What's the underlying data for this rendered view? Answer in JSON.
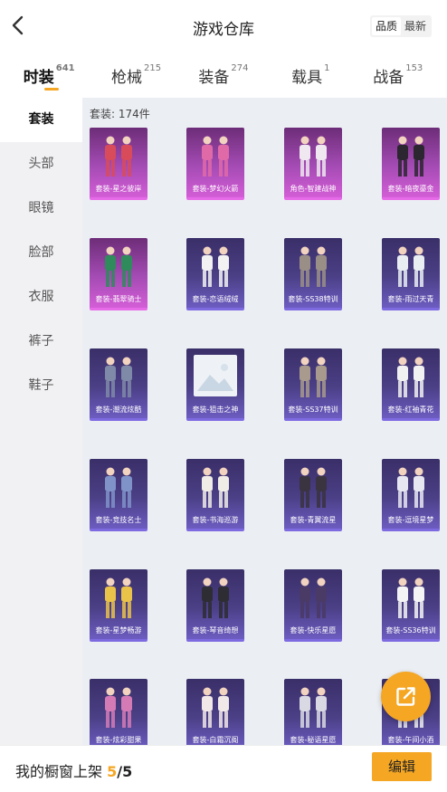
{
  "header": {
    "title": "游戏仓库",
    "sort_options": [
      "品质",
      "最新"
    ],
    "sort_active": 0
  },
  "tabs": [
    {
      "label": "时装",
      "count": "641",
      "active": true
    },
    {
      "label": "枪械",
      "count": "215",
      "active": false
    },
    {
      "label": "装备",
      "count": "274",
      "active": false
    },
    {
      "label": "载具",
      "count": "1",
      "active": false
    },
    {
      "label": "战备",
      "count": "153",
      "active": false
    }
  ],
  "sidebar": {
    "items": [
      {
        "label": "套装",
        "active": true
      },
      {
        "label": "头部",
        "active": false
      },
      {
        "label": "眼镜",
        "active": false
      },
      {
        "label": "脸部",
        "active": false
      },
      {
        "label": "衣服",
        "active": false
      },
      {
        "label": "裤子",
        "active": false
      },
      {
        "label": "鞋子",
        "active": false
      }
    ]
  },
  "main": {
    "count_label": "套装: 174件",
    "items": [
      {
        "label": "套装-星之彼岸",
        "rarity": "pink"
      },
      {
        "label": "套装-梦幻火箭",
        "rarity": "pink"
      },
      {
        "label": "角色-智建战神",
        "rarity": "pink"
      },
      {
        "label": "套装-暗夜鎏金",
        "rarity": "pink"
      },
      {
        "label": "套装-翡翠骑士",
        "rarity": "pink"
      },
      {
        "label": "套装-恋语绒绒",
        "rarity": "purple"
      },
      {
        "label": "套装-SS38特训",
        "rarity": "purple"
      },
      {
        "label": "套装-雨过天青",
        "rarity": "purple"
      },
      {
        "label": "套装-潮流炫酷",
        "rarity": "purple"
      },
      {
        "label": "套装-狙击之神",
        "rarity": "purple",
        "placeholder": true
      },
      {
        "label": "套装-SS37特训",
        "rarity": "purple"
      },
      {
        "label": "套装-红袖青花",
        "rarity": "purple"
      },
      {
        "label": "套装-竞技名士",
        "rarity": "purple"
      },
      {
        "label": "套装-书海巡游",
        "rarity": "purple"
      },
      {
        "label": "套装-青翼流星",
        "rarity": "purple"
      },
      {
        "label": "套装-逗境星梦",
        "rarity": "purple"
      },
      {
        "label": "套装-星梦畅游",
        "rarity": "purple"
      },
      {
        "label": "套装-琴音绮想",
        "rarity": "purple"
      },
      {
        "label": "套装-快乐星愿",
        "rarity": "purple"
      },
      {
        "label": "套装-SS36特训",
        "rarity": "purple"
      },
      {
        "label": "套装-炫彩甜果",
        "rarity": "purple"
      },
      {
        "label": "套装-白霜沉阁",
        "rarity": "purple"
      },
      {
        "label": "套装-秘语星愿",
        "rarity": "purple"
      },
      {
        "label": "套装-午间小酒",
        "rarity": "purple"
      }
    ]
  },
  "bottom": {
    "shelf_label": "我的橱窗上架 ",
    "shelf_count": "5",
    "shelf_total": "/5",
    "edit_label": "编辑"
  },
  "fab": {
    "icon": "share-export-icon"
  },
  "colors": {
    "accent": "#f5a623",
    "pink_rarity": "#d35dd6",
    "purple_rarity": "#6c5cc0"
  }
}
